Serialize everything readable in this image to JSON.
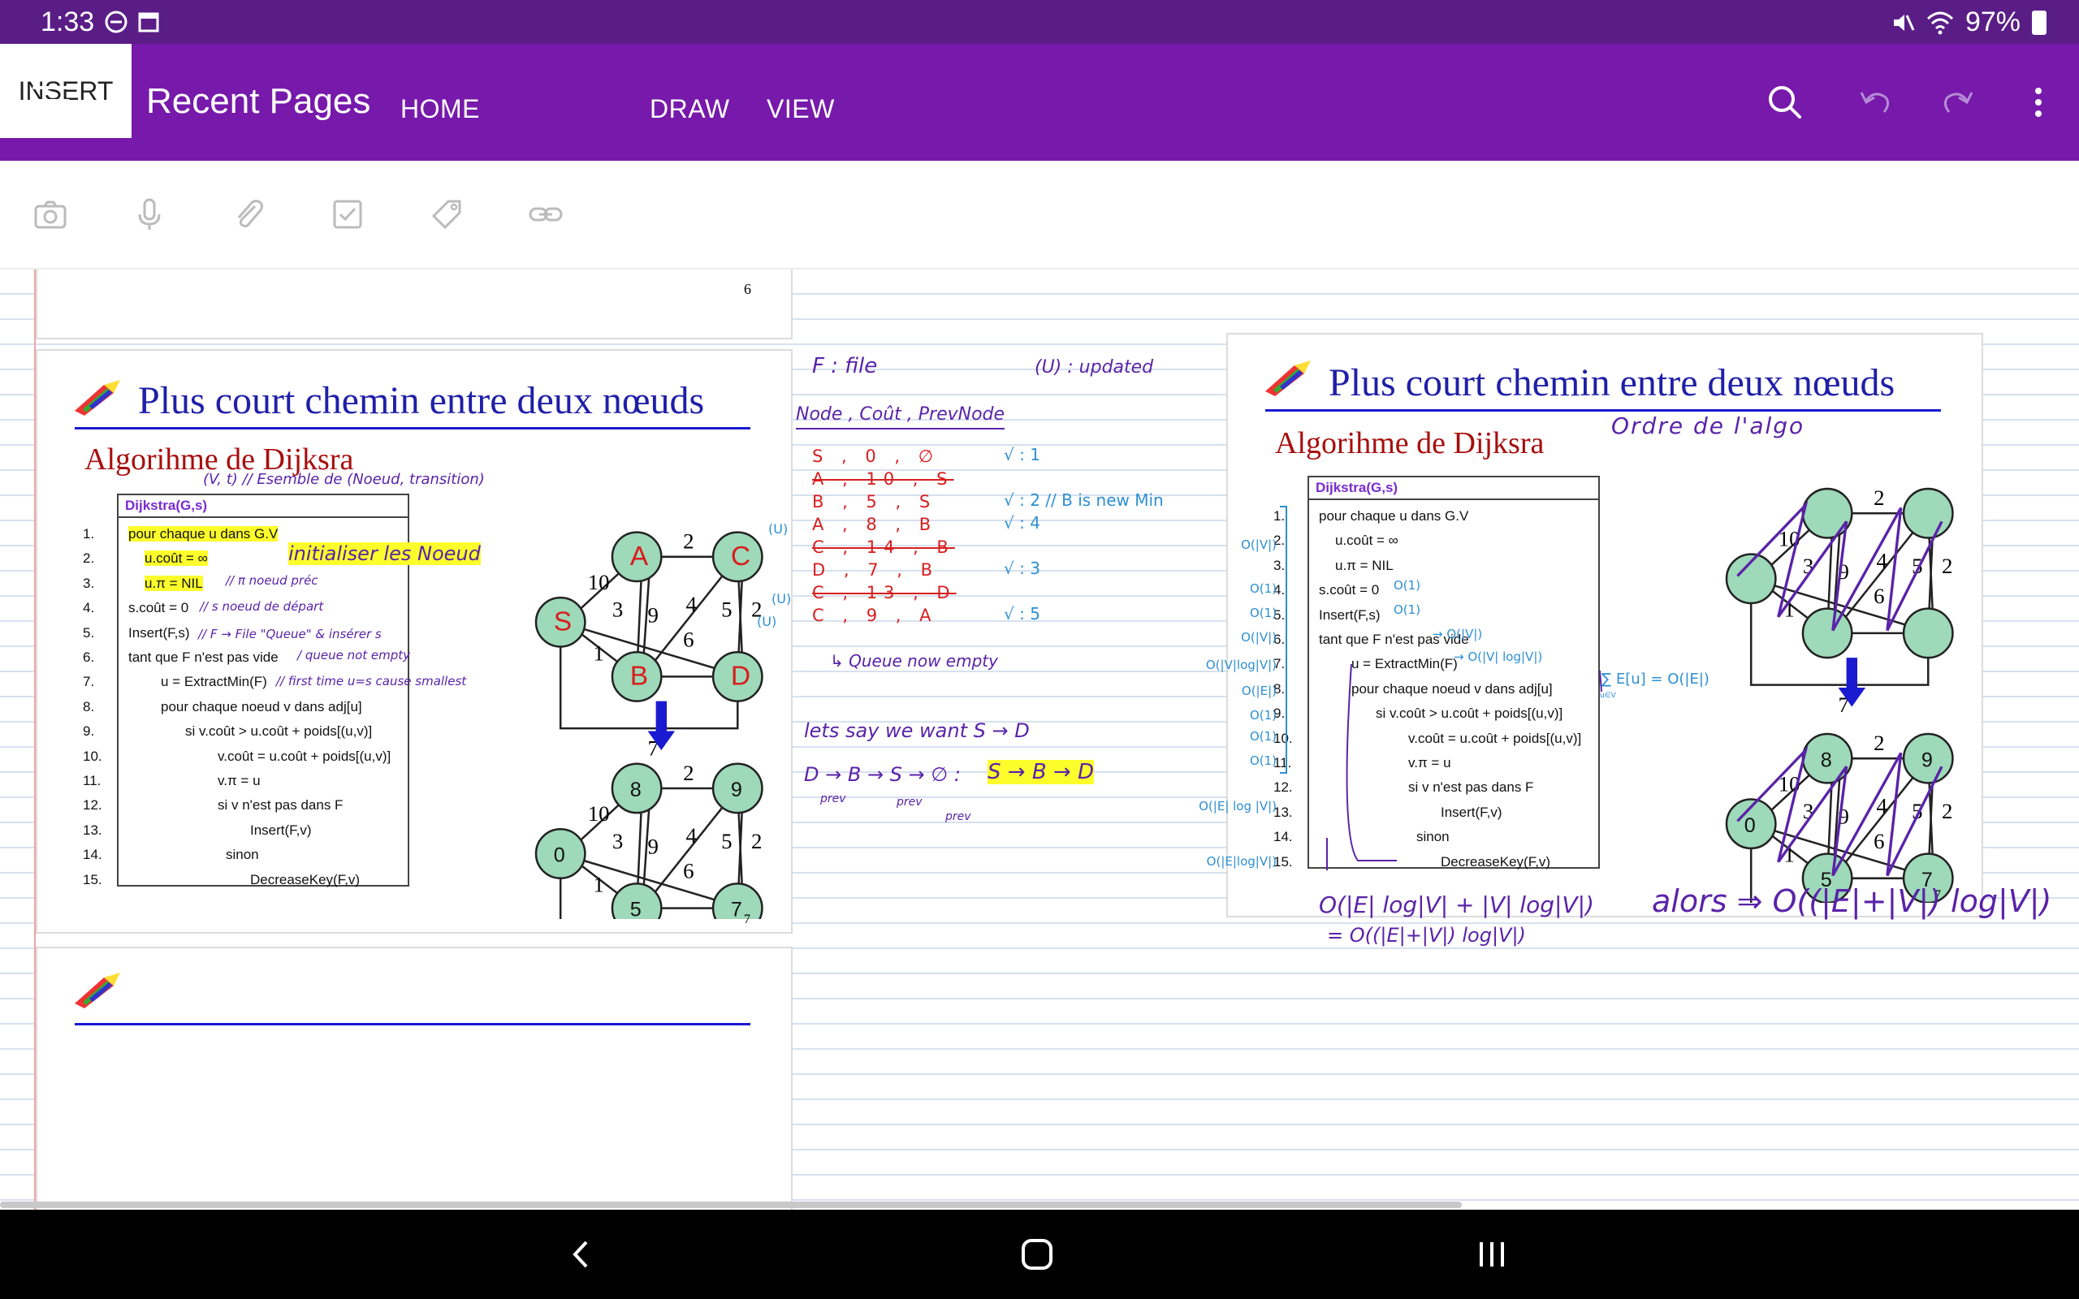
{
  "status": {
    "time": "1:33",
    "battery": "97%"
  },
  "appbar": {
    "title": "Recent Pages",
    "tabs": [
      {
        "label": "HOME",
        "active": false
      },
      {
        "label": "INSERT",
        "active": true
      },
      {
        "label": "DRAW",
        "active": false
      },
      {
        "label": "VIEW",
        "active": false
      }
    ],
    "icons": [
      "search-icon",
      "undo-icon",
      "redo-icon",
      "more-icon"
    ]
  },
  "ribbon": {
    "icons": [
      "camera-icon",
      "microphone-icon",
      "paperclip-icon",
      "checkbox-icon",
      "tag-icon",
      "link-icon"
    ]
  },
  "colors": {
    "accent": "#7719aa",
    "status": "#5a1d86",
    "ink_purple": "#5a23a8",
    "ink_blue": "#2d8fd4",
    "ink_red": "#d81e1e",
    "highlight": "#fdfd2b"
  },
  "slide_top": {
    "page_number": "6"
  },
  "slide_left": {
    "title": "Plus court chemin entre deux nœuds",
    "algo_title": "Algorihme de Dijksra",
    "page_number": "7",
    "box_title": "Dijkstra(G,s)",
    "lines": [
      "pour chaque u dans G.V",
      "u.coût = ∞",
      "u.π = NIL",
      "s.coût = 0",
      "Insert(F,s)",
      "tant que F n'est pas vide",
      "u = ExtractMin(F)",
      "pour chaque noeud v dans adj[u]",
      "si v.coût > u.coût + poids[(u,v)]",
      "v.coût = u.coût + poids[(u,v)]",
      "v.π = u",
      "si v n'est pas dans F",
      "Insert(F,v)",
      "sinon",
      "DecreaseKey(F,v)"
    ],
    "line_numbers": [
      "1.",
      "2.",
      "3.",
      "4.",
      "5.",
      "6.",
      "7.",
      "8.",
      "9.",
      "10.",
      "11.",
      "12.",
      "13.",
      "14.",
      "15."
    ],
    "graph1_nodes": [
      "S",
      "A",
      "B",
      "C",
      "D"
    ],
    "graph2_nodes": [
      "0",
      "8",
      "5",
      "9",
      "7"
    ],
    "edge_weights": [
      "10",
      "1",
      "3",
      "2",
      "9",
      "6",
      "4",
      "5",
      "2",
      "7"
    ]
  },
  "slide_right": {
    "title": "Plus court chemin entre deux nœuds",
    "algo_title": "Algorihme de Dijksra",
    "page_number": "7",
    "box_title": "Dijkstra(G,s)"
  },
  "slide_bottom": {
    "title": ""
  },
  "handwriting": {
    "left_notes": {
      "vt": "(V, t) // Esemble de (Noeud, transition)",
      "init": "initialiser les Noeud",
      "pi": "// π noeud préc",
      "sdep": "// s noeud de départ",
      "insert": "// F → File \"Queue\" & insérer s",
      "queue": "/ queue not empty",
      "first": "// first time u=s cause smallest"
    },
    "file_title": "F : file",
    "updated": "(U) : updated",
    "table_header": "Node , Coût , PrevNode",
    "table_rows": [
      {
        "row": "S , 0 , ∅",
        "mark": "√ : 1",
        "struck": false,
        "color": "red"
      },
      {
        "row": "A , 10 , S",
        "mark": "",
        "struck": true,
        "color": "red"
      },
      {
        "row": "B , 5 , S",
        "mark": "√ : 2  // B is new Min",
        "struck": false,
        "color": "red"
      },
      {
        "row": "A , 8 , B",
        "mark": "√ : 4",
        "struck": false,
        "color": "red"
      },
      {
        "row": "C , 14 , B",
        "mark": "",
        "struck": true,
        "color": "red"
      },
      {
        "row": "D , 7 , B",
        "mark": "√ : 3",
        "struck": false,
        "color": "red"
      },
      {
        "row": "C , 13 , D",
        "mark": "",
        "struck": true,
        "color": "red"
      },
      {
        "row": "C , 9 , A",
        "mark": "√ : 5",
        "struck": false,
        "color": "red"
      }
    ],
    "side_marks": [
      "(U)",
      "(U)",
      "(U)"
    ],
    "queue_empty": "↳ Queue now empty",
    "lets_say": "lets say we want S → D",
    "path_line": "D → B → S → ∅ :",
    "path_result": "S → B → D",
    "prev_labels": [
      "prev",
      "prev",
      "prev"
    ],
    "order_title": "Ordre de l'algo",
    "complexities": [
      "O(|V|)",
      "O(1)",
      "O(1)",
      "O(|V|)",
      "O(|V|log|V|)",
      "O(|E|)",
      "O(1)",
      "O(1)",
      "O(1)",
      "O(|E| log |V|)",
      "O(|E|log|V|)"
    ],
    "inline_c": [
      "O(1)",
      "O(1)",
      "→ O(|V|)",
      "→ O(|V| log|V|)"
    ],
    "sum_note": "∑ E[u] = O(|E|)",
    "sum_sub": "u∈V",
    "total1": "O(|E| log|V| + |V| log|V|)",
    "total2": "= O((|E|+|V|) log|V|)",
    "alors": "alors ⇒ O((|E|+|V|) log|V|)"
  }
}
